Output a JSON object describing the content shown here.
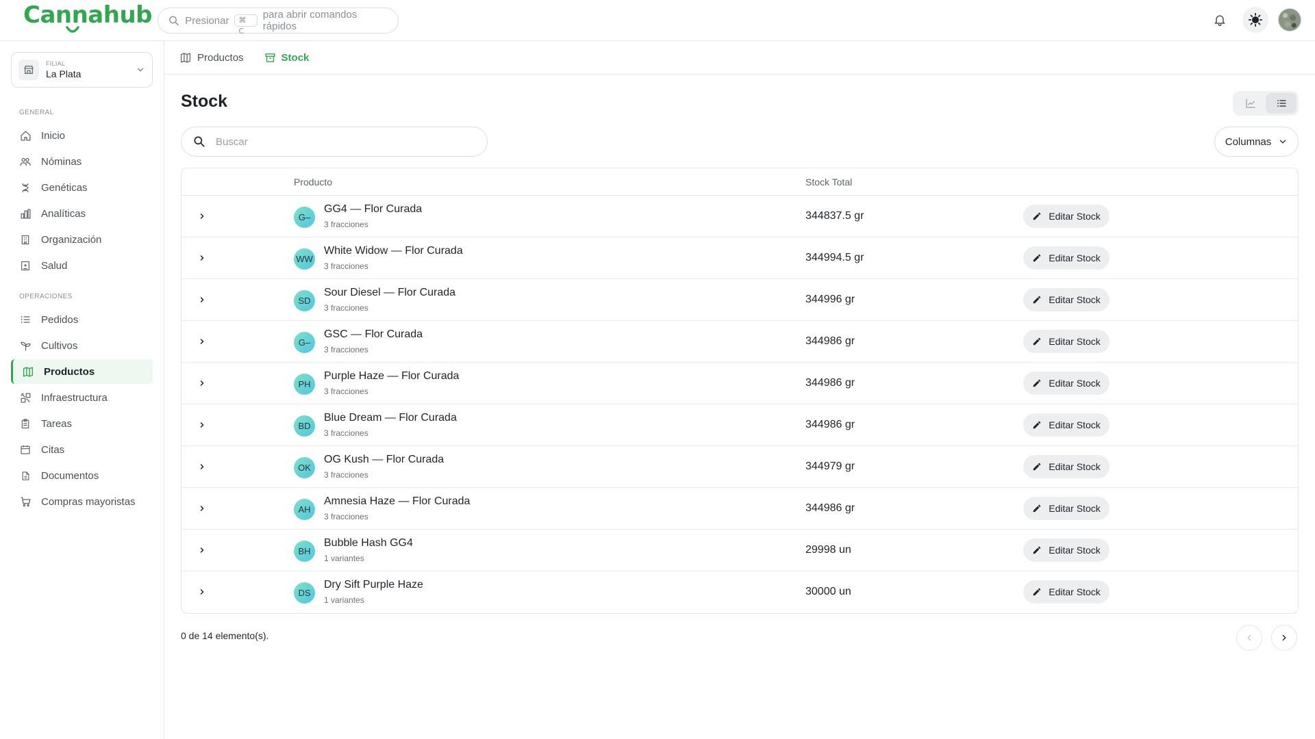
{
  "app": {
    "logo_text": "Cannahub",
    "brand_color": "#2fa84f",
    "command_search": {
      "prefix": "Presionar",
      "shortcut": "⌘ C",
      "suffix": "para abrir comandos rápidos"
    },
    "header_icons": [
      "bell-icon",
      "sun-icon",
      "user-avatar"
    ]
  },
  "sidebar": {
    "branch": {
      "caption": "FILIAL",
      "name": "La Plata"
    },
    "sections": [
      {
        "title": "GENERAL",
        "items": [
          {
            "label": "Inicio",
            "icon": "home-icon"
          },
          {
            "label": "Nóminas",
            "icon": "people-icon"
          },
          {
            "label": "Genéticas",
            "icon": "dna-icon"
          },
          {
            "label": "Analíticas",
            "icon": "bar-chart-icon"
          },
          {
            "label": "Organización",
            "icon": "building-icon"
          },
          {
            "label": "Salud",
            "icon": "medical-icon"
          }
        ]
      },
      {
        "title": "OPERACIONES",
        "items": [
          {
            "label": "Pedidos",
            "icon": "list-icon"
          },
          {
            "label": "Cultivos",
            "icon": "sprout-icon"
          },
          {
            "label": "Productos",
            "icon": "box-icon",
            "active": true
          },
          {
            "label": "Infraestructura",
            "icon": "tools-icon"
          },
          {
            "label": "Tareas",
            "icon": "clipboard-icon"
          },
          {
            "label": "Citas",
            "icon": "calendar-icon"
          },
          {
            "label": "Documentos",
            "icon": "document-icon"
          },
          {
            "label": "Compras mayoristas",
            "icon": "cart-icon"
          }
        ]
      }
    ]
  },
  "tabs": [
    {
      "label": "Productos",
      "icon": "box-icon",
      "active": false
    },
    {
      "label": "Stock",
      "icon": "archive-icon",
      "active": true
    }
  ],
  "page": {
    "title": "Stock",
    "search_placeholder": "Buscar",
    "columns_label": "Columnas",
    "view_toggle": [
      "chart-view",
      "list-view"
    ],
    "active_view": "list-view"
  },
  "table": {
    "headers": {
      "product": "Producto",
      "stock": "Stock Total"
    },
    "edit_label": "Editar Stock",
    "rows": [
      {
        "initials": "G–",
        "name": "GG4 — Flor Curada",
        "sub": "3 fracciones",
        "stock": "344837.5 gr"
      },
      {
        "initials": "WW",
        "name": "White Widow — Flor Curada",
        "sub": "3 fracciones",
        "stock": "344994.5 gr"
      },
      {
        "initials": "SD",
        "name": "Sour Diesel — Flor Curada",
        "sub": "3 fracciones",
        "stock": "344996 gr"
      },
      {
        "initials": "G–",
        "name": "GSC — Flor Curada",
        "sub": "3 fracciones",
        "stock": "344986 gr"
      },
      {
        "initials": "PH",
        "name": "Purple Haze — Flor Curada",
        "sub": "3 fracciones",
        "stock": "344986 gr"
      },
      {
        "initials": "BD",
        "name": "Blue Dream — Flor Curada",
        "sub": "3 fracciones",
        "stock": "344986 gr"
      },
      {
        "initials": "OK",
        "name": "OG Kush — Flor Curada",
        "sub": "3 fracciones",
        "stock": "344979 gr"
      },
      {
        "initials": "AH",
        "name": "Amnesia Haze — Flor Curada",
        "sub": "3 fracciones",
        "stock": "344986 gr"
      },
      {
        "initials": "BH",
        "name": "Bubble Hash GG4",
        "sub": "1 variantes",
        "stock": "29998 un"
      },
      {
        "initials": "DS",
        "name": "Dry Sift Purple Haze",
        "sub": "1 variantes",
        "stock": "30000 un"
      }
    ]
  },
  "footer": {
    "count_text": "0 de 14 elemento(s)."
  }
}
